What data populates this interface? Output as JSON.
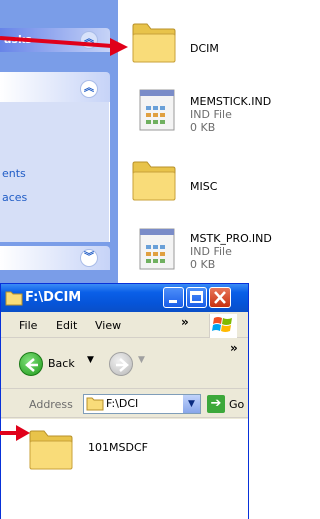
{
  "background_window": {
    "task_pane": {
      "section1_title": "asks",
      "links": [
        "ents",
        "aces"
      ]
    },
    "files": [
      {
        "name": "DCIM",
        "icon": "folder-icon"
      },
      {
        "name": "MEMSTICK.IND",
        "type": "IND File",
        "size": "0 KB",
        "icon": "ind-file-icon"
      },
      {
        "name": "MISC",
        "icon": "folder-icon"
      },
      {
        "name": "MSTK_PRO.IND",
        "type": "IND File",
        "size": "0 KB",
        "icon": "ind-file-icon"
      }
    ]
  },
  "foreground_window": {
    "title": "F:\\DCIM",
    "menu": {
      "file": "File",
      "edit": "Edit",
      "view": "View",
      "more": "»"
    },
    "toolbar": {
      "back": "Back",
      "more": "»"
    },
    "address": {
      "label": "Address",
      "value": "F:\\DCI",
      "go": "Go"
    },
    "content": {
      "folder_name": "101MSDCF"
    }
  },
  "colors": {
    "annotation_arrow": "#e0001a",
    "title_bar": "#0654d8",
    "task_pane": "#7a9de8",
    "folder_yellow": "#f7d76a"
  }
}
